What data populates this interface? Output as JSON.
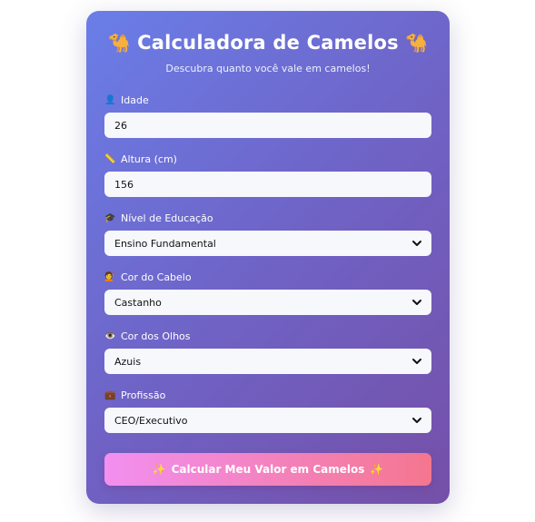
{
  "header": {
    "title": "Calculadora de Camelos",
    "left_emoji": "🐪",
    "right_emoji": "🐪",
    "subtitle": "Descubra quanto você vale em camelos!"
  },
  "fields": [
    {
      "icon": "👤",
      "icon_name": "person-icon",
      "label": "Idade",
      "value": "26",
      "type": "input"
    },
    {
      "icon": "📏",
      "icon_name": "ruler-icon",
      "label": "Altura (cm)",
      "value": "156",
      "type": "input"
    },
    {
      "icon": "🎓",
      "icon_name": "graduation-cap-icon",
      "label": "Nível de Educação",
      "value": "Ensino Fundamental",
      "type": "select"
    },
    {
      "icon": "💇",
      "icon_name": "haircut-icon",
      "label": "Cor do Cabelo",
      "value": "Castanho",
      "type": "select"
    },
    {
      "icon": "👁️",
      "icon_name": "eye-icon",
      "label": "Cor dos Olhos",
      "value": "Azuis",
      "type": "select"
    },
    {
      "icon": "💼",
      "icon_name": "briefcase-icon",
      "label": "Profissão",
      "value": "CEO/Executivo",
      "type": "select"
    }
  ],
  "button": {
    "label": "Calcular Meu Valor em Camelos",
    "left_emoji": "✨",
    "right_emoji": "✨"
  },
  "colors": {
    "card_gradient_start": "#6a7ee8",
    "card_gradient_end": "#7550a8",
    "button_gradient_start": "#f28ff0",
    "button_gradient_end": "#f4768f",
    "field_bg": "#f7f8fc"
  }
}
